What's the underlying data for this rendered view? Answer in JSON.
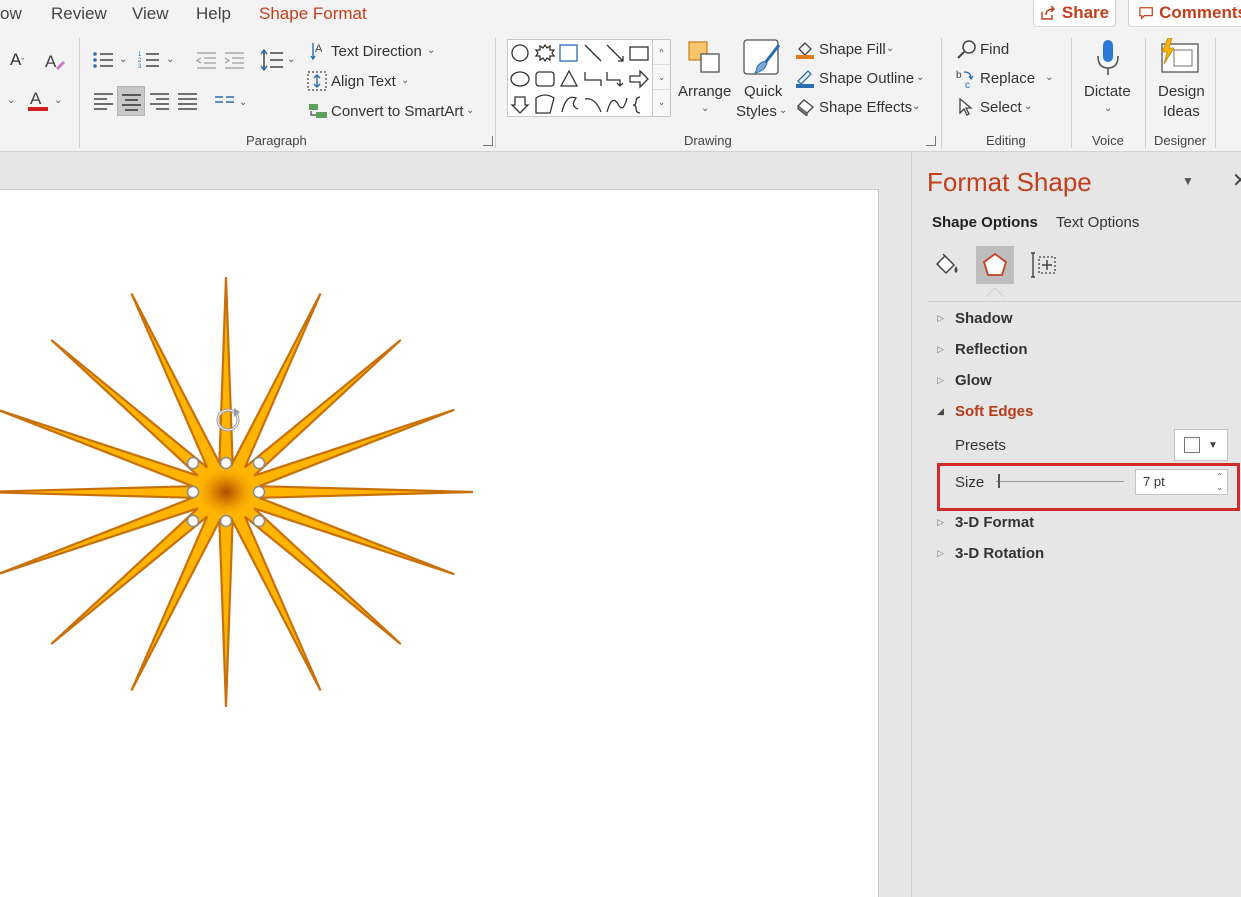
{
  "menu": {
    "tabs": [
      "ow",
      "Review",
      "View",
      "Help",
      "Shape Format"
    ],
    "active_tab": "Shape Format",
    "share_label": "Share",
    "comments_label": "Comments"
  },
  "ribbon": {
    "paragraph": {
      "text_direction": "Text Direction",
      "align_text": "Align Text",
      "convert_smartart": "Convert to SmartArt",
      "group_label": "Paragraph"
    },
    "drawing": {
      "arrange": "Arrange",
      "quick_styles_1": "Quick",
      "quick_styles_2": "Styles",
      "shape_fill": "Shape Fill",
      "shape_outline": "Shape Outline",
      "shape_effects": "Shape Effects",
      "group_label": "Drawing"
    },
    "editing": {
      "find": "Find",
      "replace": "Replace",
      "select": "Select",
      "group_label": "Editing"
    },
    "voice": {
      "dictate": "Dictate",
      "group_label": "Voice"
    },
    "designer": {
      "design_1": "Design",
      "design_2": "Ideas",
      "group_label": "Designer"
    }
  },
  "pane": {
    "title": "Format Shape",
    "tabs": {
      "shape_options": "Shape Options",
      "text_options": "Text Options"
    },
    "sections": {
      "shadow": "Shadow",
      "reflection": "Reflection",
      "glow": "Glow",
      "soft_edges": "Soft Edges",
      "format_3d": "3-D Format",
      "rotation_3d": "3-D Rotation"
    },
    "presets_label": "Presets",
    "size_label": "Size",
    "size_value": "7 pt"
  },
  "colors": {
    "accent": "#c43e1c",
    "star_fill": "#ffb400",
    "star_outline": "#c8700c",
    "highlight": "#d12a2a"
  }
}
